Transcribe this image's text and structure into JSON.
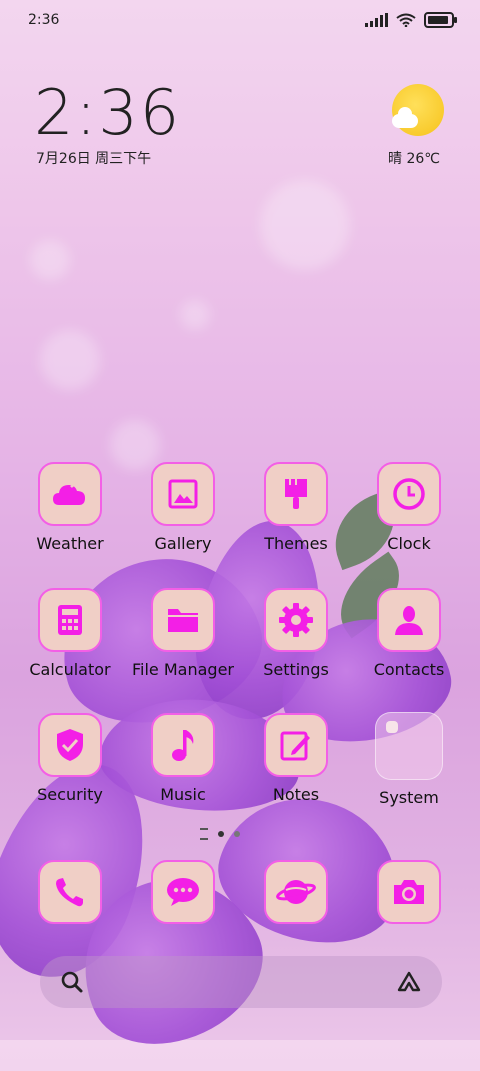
{
  "status_bar": {
    "time": "2:36"
  },
  "widget": {
    "time": "2:36",
    "date": "7月26日 周三下午",
    "weather": "晴 26℃"
  },
  "apps": [
    {
      "label": "Weather",
      "icon": "weather-icon"
    },
    {
      "label": "Gallery",
      "icon": "gallery-icon"
    },
    {
      "label": "Themes",
      "icon": "themes-brush-icon"
    },
    {
      "label": "Clock",
      "icon": "clock-icon"
    },
    {
      "label": "Calculator",
      "icon": "calculator-icon"
    },
    {
      "label": "File Manager",
      "icon": "folder-icon"
    },
    {
      "label": "Settings",
      "icon": "gear-icon"
    },
    {
      "label": "Contacts",
      "icon": "person-icon"
    },
    {
      "label": "Security",
      "icon": "shield-check-icon"
    },
    {
      "label": "Music",
      "icon": "music-note-icon"
    },
    {
      "label": "Notes",
      "icon": "note-edit-icon"
    },
    {
      "label": "System",
      "icon": "system-folder-icon"
    }
  ],
  "dock": [
    {
      "icon": "phone-icon"
    },
    {
      "icon": "message-icon"
    },
    {
      "icon": "browser-planet-icon"
    },
    {
      "icon": "camera-icon"
    }
  ],
  "colors": {
    "accent": "#f31fe6",
    "tile": "#f0cfc6"
  }
}
